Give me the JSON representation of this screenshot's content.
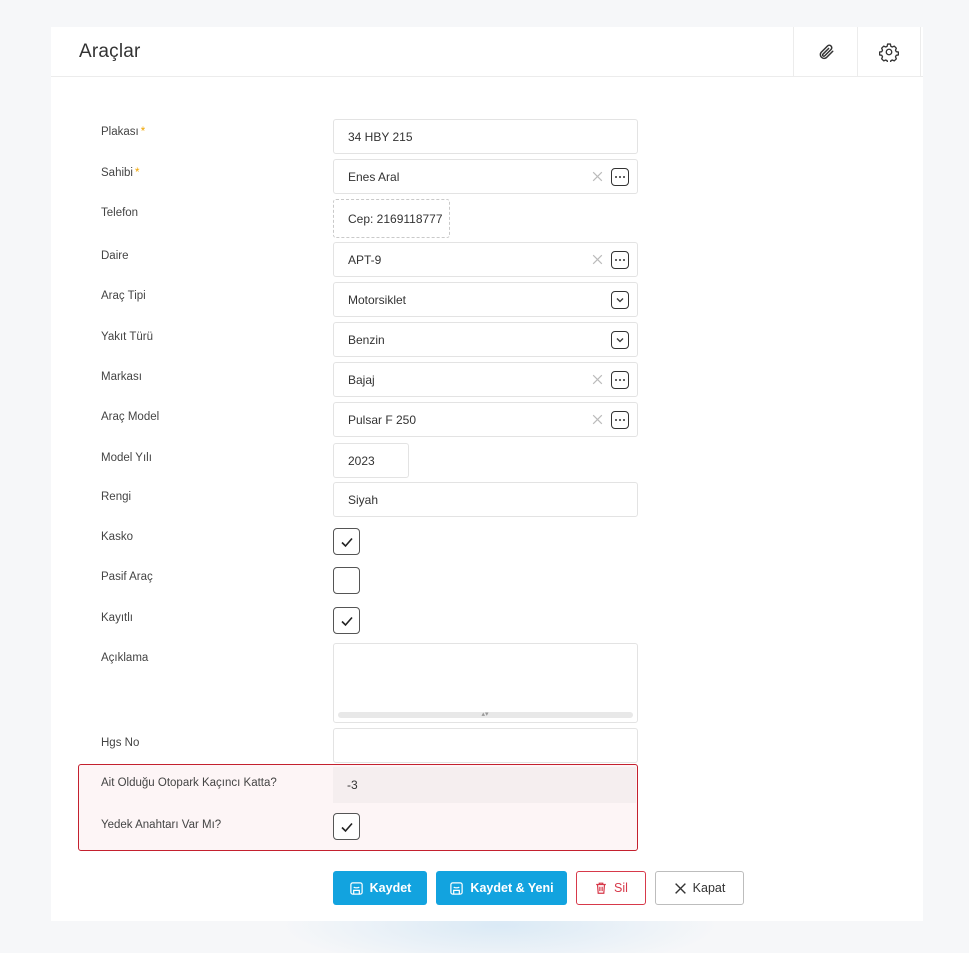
{
  "header": {
    "title": "Araçlar",
    "icons": [
      "paperclip-icon",
      "gear-icon"
    ]
  },
  "form": {
    "plaka": {
      "label": "Plakası",
      "required": "*",
      "value": "34 HBY 215"
    },
    "sahibi": {
      "label": "Sahibi",
      "required": "*",
      "value": "Enes Aral"
    },
    "telefon": {
      "label": "Telefon",
      "value": "Cep: 2169118777"
    },
    "daire": {
      "label": "Daire",
      "value": "APT-9"
    },
    "arac_tipi": {
      "label": "Araç Tipi",
      "value": "Motorsiklet"
    },
    "yakit_turu": {
      "label": "Yakıt Türü",
      "value": "Benzin"
    },
    "markasi": {
      "label": "Markası",
      "value": "Bajaj"
    },
    "arac_model": {
      "label": "Araç Model",
      "value": "Pulsar F 250"
    },
    "model_yili": {
      "label": "Model Yılı",
      "value": "2023"
    },
    "rengi": {
      "label": "Rengi",
      "value": "Siyah"
    },
    "kasko": {
      "label": "Kasko",
      "checked": true
    },
    "pasif_arac": {
      "label": "Pasif Araç",
      "checked": false
    },
    "kayitli": {
      "label": "Kayıtlı",
      "checked": true
    },
    "aciklama": {
      "label": "Açıklama",
      "value": ""
    },
    "hgs_no": {
      "label": "Hgs No",
      "value": ""
    },
    "otopark_kat": {
      "label": "Ait Olduğu Otopark Kaçıncı Katta?",
      "value": "-3"
    },
    "yedek_anahtar": {
      "label": "Yedek Anahtarı Var Mı?",
      "checked": true
    }
  },
  "actions": {
    "save": "Kaydet",
    "save_new": "Kaydet & Yeni",
    "delete": "Sil",
    "close": "Kapat"
  },
  "colors": {
    "primary": "#12a3df",
    "danger": "#d7394a",
    "highlight_border": "#c4202e",
    "required": "#f0a500"
  }
}
